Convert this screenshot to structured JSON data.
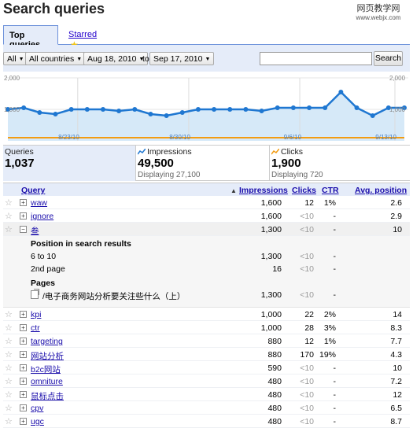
{
  "page_title": "Search queries",
  "watermark": {
    "line1": "网页教学网",
    "line2": "www.webjx.com"
  },
  "tabs": [
    {
      "label": "Top queries",
      "active": true
    },
    {
      "label": "Starred",
      "active": false
    }
  ],
  "toolbar": {
    "filter_all": "All",
    "filter_country": "All countries",
    "date_from": "Aug 18, 2010",
    "to_label": "to",
    "date_to": "Sep 17, 2010",
    "search_value": "",
    "search_button": "Search"
  },
  "chart_data": {
    "type": "line",
    "ylim": [
      0,
      2000
    ],
    "y_ticks_left": [
      "2,000",
      "1,000"
    ],
    "y_ticks_right": [
      "2,000",
      "1,000"
    ],
    "x_labels": [
      "8/23/10",
      "8/30/10",
      "9/6/10",
      "9/13/10"
    ],
    "impressions": [
      1000,
      1050,
      900,
      850,
      1000,
      1000,
      1000,
      950,
      1000,
      850,
      800,
      900,
      1000,
      1000,
      1000,
      1000,
      950,
      1050,
      1050,
      1050,
      1050,
      1550,
      1050,
      800,
      1050,
      1050
    ],
    "clicks": [
      20,
      20,
      20,
      20,
      20,
      20,
      20,
      20,
      20,
      20,
      20,
      20,
      20,
      20,
      20,
      20,
      20,
      20,
      20,
      20,
      20,
      20,
      20,
      20,
      20,
      20
    ],
    "colors": {
      "impressions": "#1f77d1",
      "fill": "#d6e9f8",
      "clicks": "#f39c12"
    }
  },
  "summary": {
    "queries": {
      "label": "Queries",
      "value": "1,037"
    },
    "impressions": {
      "label": "Impressions",
      "value": "49,500",
      "sub": "Displaying 27,100"
    },
    "clicks": {
      "label": "Clicks",
      "value": "1,900",
      "sub": "Displaying 720"
    }
  },
  "table": {
    "headers": {
      "query": "Query",
      "impressions": "Impressions",
      "clicks": "Clicks",
      "ctr": "CTR",
      "avg_position": "Avg. position"
    },
    "rows_top": [
      {
        "query": "waw",
        "impressions": "1,600",
        "clicks": "12",
        "ctr": "1%",
        "position": "2.6"
      },
      {
        "query": "ignore",
        "impressions": "1,600",
        "clicks": "<10",
        "ctr": "-",
        "position": "2.9"
      }
    ],
    "expanded": {
      "query": "叁",
      "impressions": "1,300",
      "clicks": "<10",
      "ctr": "-",
      "position": "10",
      "section1_title": "Position in search results",
      "positions": [
        {
          "label": "6 to 10",
          "impressions": "1,300",
          "clicks": "<10",
          "ctr": "-"
        },
        {
          "label": "2nd page",
          "impressions": "16",
          "clicks": "<10",
          "ctr": "-"
        }
      ],
      "section2_title": "Pages",
      "page": {
        "label": "/电子商务网站分析要关注些什么（上）",
        "impressions": "1,300",
        "clicks": "<10",
        "ctr": "-"
      }
    },
    "rows_bottom": [
      {
        "query": "kpi",
        "impressions": "1,000",
        "clicks": "22",
        "ctr": "2%",
        "position": "14"
      },
      {
        "query": "ctr",
        "impressions": "1,000",
        "clicks": "28",
        "ctr": "3%",
        "position": "8.3"
      },
      {
        "query": "targeting",
        "impressions": "880",
        "clicks": "12",
        "ctr": "1%",
        "position": "7.7"
      },
      {
        "query": "网站分析",
        "impressions": "880",
        "clicks": "170",
        "ctr": "19%",
        "position": "4.3"
      },
      {
        "query": "b2c网站",
        "impressions": "590",
        "clicks": "<10",
        "ctr": "-",
        "position": "10"
      },
      {
        "query": "omniture",
        "impressions": "480",
        "clicks": "<10",
        "ctr": "-",
        "position": "7.2"
      },
      {
        "query": "鼠标点击",
        "impressions": "480",
        "clicks": "<10",
        "ctr": "-",
        "position": "12"
      },
      {
        "query": "cpv",
        "impressions": "480",
        "clicks": "<10",
        "ctr": "-",
        "position": "6.5"
      },
      {
        "query": "ugc",
        "impressions": "480",
        "clicks": "<10",
        "ctr": "-",
        "position": "8.7"
      }
    ]
  }
}
